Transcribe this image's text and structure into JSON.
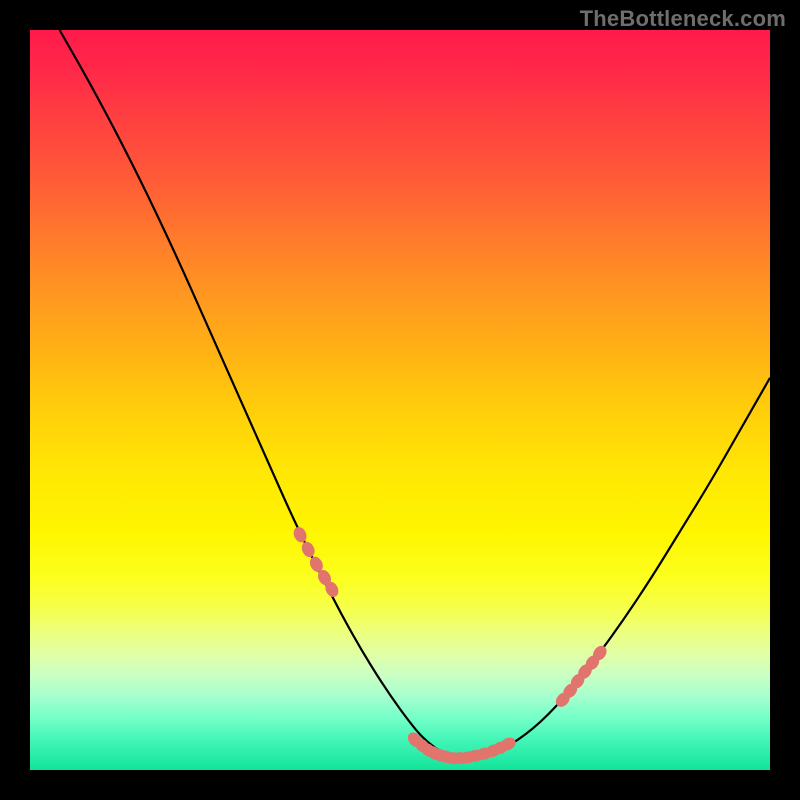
{
  "watermark": "TheBottleneck.com",
  "chart_data": {
    "type": "line",
    "title": "",
    "xlabel": "",
    "ylabel": "",
    "xlim": [
      0,
      100
    ],
    "ylim": [
      0,
      100
    ],
    "grid": false,
    "legend": false,
    "series": [
      {
        "name": "curve",
        "x": [
          4,
          8,
          12,
          16,
          20,
          24,
          28,
          32,
          36,
          40,
          44,
          48,
          52,
          54,
          56,
          58,
          60,
          64,
          68,
          72,
          76,
          80,
          84,
          88,
          92,
          96,
          100
        ],
        "y": [
          100,
          93,
          85.5,
          77.5,
          69,
          60,
          51,
          42,
          33,
          25,
          17.5,
          11,
          5.5,
          3.5,
          2.2,
          1.6,
          1.6,
          2.8,
          5.5,
          9.5,
          14.5,
          20,
          26,
          32.5,
          39,
          46,
          53
        ]
      }
    ],
    "markers": {
      "name": "highlight-points",
      "color": "#e2746e",
      "x": [
        36.5,
        37.6,
        38.7,
        39.8,
        40.8,
        52.0,
        53.0,
        53.8,
        54.6,
        55.4,
        56.2,
        57.2,
        58.2,
        59.2,
        60.2,
        61.4,
        62.6,
        63.6,
        64.6,
        72.0,
        73.0,
        74.0,
        75.0,
        76.0,
        77.0
      ],
      "y": [
        31.8,
        29.8,
        27.8,
        26.0,
        24.4,
        4.1,
        3.3,
        2.7,
        2.3,
        2.0,
        1.8,
        1.6,
        1.6,
        1.7,
        1.9,
        2.2,
        2.6,
        3.0,
        3.5,
        9.5,
        10.7,
        12.0,
        13.3,
        14.5,
        15.8
      ]
    },
    "background_gradient": {
      "top": "#ff1a4a",
      "mid": "#fff600",
      "bottom": "#12e49a"
    }
  }
}
